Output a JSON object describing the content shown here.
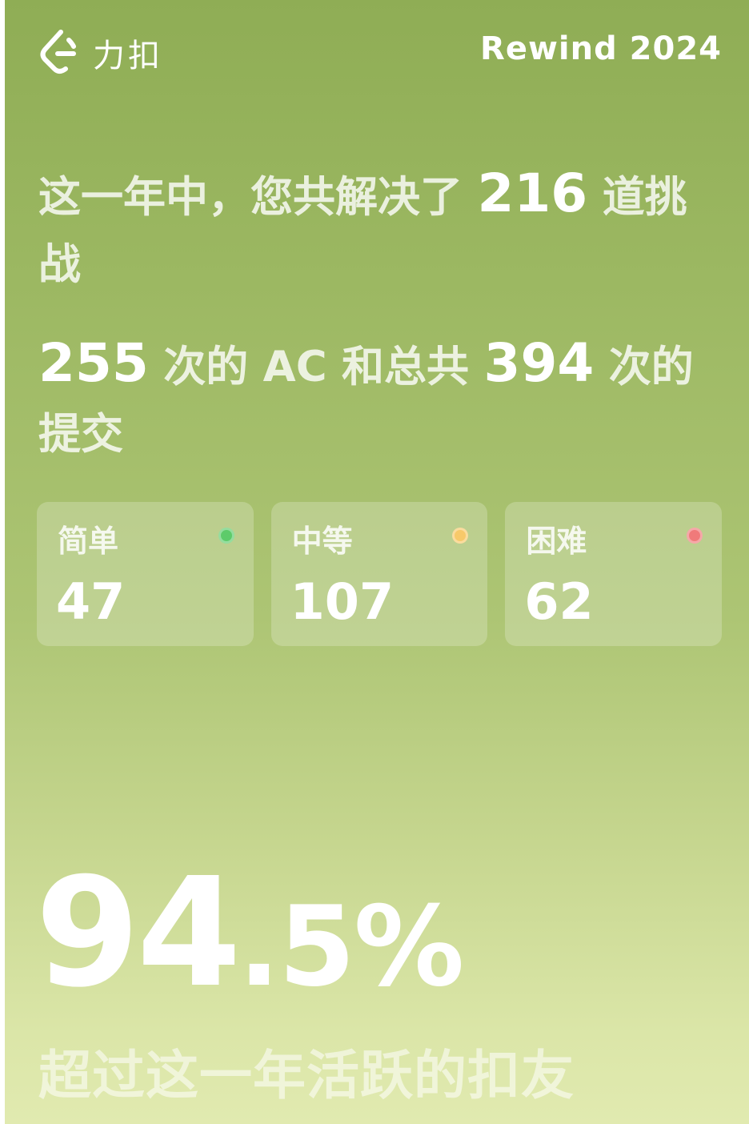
{
  "header": {
    "logo_text": "力扣",
    "title": "Rewind 2024"
  },
  "summary": {
    "solved_prefix": "这一年中，您共解决了",
    "solved_count": "216",
    "solved_suffix": "道挑战",
    "ac_count": "255",
    "ac_mid": "次的 AC 和总共",
    "submit_count": "394",
    "submit_suffix": "次的提交"
  },
  "difficulty": [
    {
      "label": "简单",
      "value": "47",
      "color": "#5dcb6a"
    },
    {
      "label": "中等",
      "value": "107",
      "color": "#f7c96a"
    },
    {
      "label": "困难",
      "value": "62",
      "color": "#f07a7a"
    }
  ],
  "percentile": {
    "integer": "94",
    "decimal": ".5%",
    "caption": "超过这一年活跃的扣友"
  }
}
